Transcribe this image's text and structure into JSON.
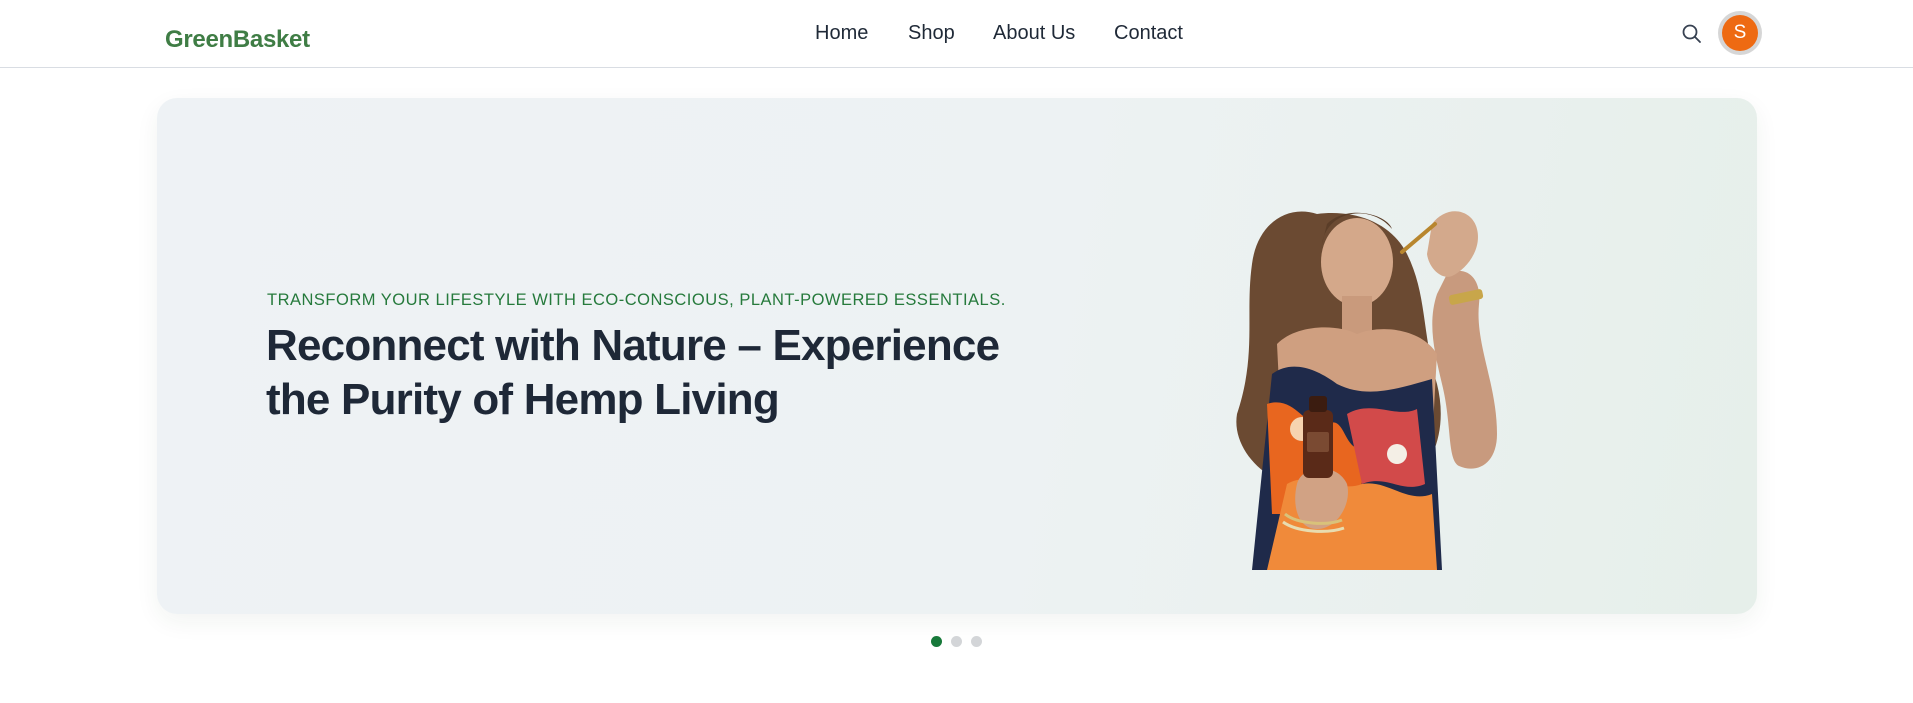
{
  "header": {
    "logo": "GreenBasket",
    "nav": [
      {
        "label": "Home"
      },
      {
        "label": "Shop"
      },
      {
        "label": "About Us"
      },
      {
        "label": "Contact"
      }
    ],
    "search_icon": "search-icon",
    "avatar_initial": "S",
    "avatar_color": "#ee6a12"
  },
  "hero": {
    "eyebrow": "TRANSFORM YOUR LIFESTYLE WITH ECO-CONSCIOUS, PLANT-POWERED ESSENTIALS.",
    "title": "Reconnect with Nature – Experience the Purity of Hemp Living",
    "image": "woman applying hemp oil dropper, holding bottle",
    "accent_color": "#267a3c"
  },
  "carousel": {
    "slides": 3,
    "active": 1,
    "active_color": "#17793a",
    "inactive_color": "#d3d5d8"
  }
}
